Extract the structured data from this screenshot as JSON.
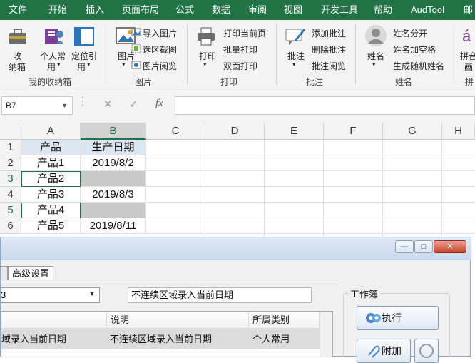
{
  "ribbon_tabs": [
    "文件",
    "开始",
    "插入",
    "页面布局",
    "公式",
    "数据",
    "审阅",
    "视图",
    "开发工具",
    "帮助",
    "AudTool",
    "邮"
  ],
  "ribbon": {
    "shoubox": {
      "btn1_line1": "收",
      "btn1_line2": "纳箱",
      "btn2_line1": "个人常",
      "btn2_line2": "用",
      "btn3_line1": "定位引",
      "btn3_line2": "用",
      "group_label": "我的收纳箱"
    },
    "picture": {
      "big_label": "图片",
      "item1": "导入图片",
      "item2": "选区截图",
      "item3": "图片阅览",
      "group_label": "图片"
    },
    "print": {
      "big_label": "打印",
      "item1": "打印当前页",
      "item2": "批量打印",
      "item3": "双面打印",
      "group_label": "打印"
    },
    "comment": {
      "big_label": "批注",
      "item1": "添加批注",
      "item2": "删除批注",
      "item3": "批注阅览",
      "group_label": "批注"
    },
    "name": {
      "big_label": "姓名",
      "item1": "姓名分开",
      "item2": "姓名加空格",
      "item3": "生成随机姓名",
      "group_label": "姓名"
    },
    "pinyin": {
      "line1": "拼音",
      "line2": "画",
      "group_label": "拼"
    }
  },
  "formula_bar": {
    "name_box": "B7",
    "cancel_glyph": "✕",
    "confirm_glyph": "✓",
    "fx_glyph": "fx",
    "formula": ""
  },
  "grid": {
    "columns": [
      "A",
      "B",
      "C",
      "D",
      "E",
      "F",
      "G",
      "H"
    ],
    "selected_column": "B",
    "rows": [
      {
        "num": "1",
        "a": "产品",
        "b": "生产日期",
        "b_fill": "header"
      },
      {
        "num": "2",
        "a": "产品1",
        "b": "2019/8/2",
        "b_fill": "none"
      },
      {
        "num": "3",
        "a": "产品2",
        "b": "",
        "b_fill": "gray"
      },
      {
        "num": "4",
        "a": "产品3",
        "b": "2019/8/3",
        "b_fill": "none"
      },
      {
        "num": "5",
        "a": "产品4",
        "b": "",
        "b_fill": "gray"
      },
      {
        "num": "6",
        "a": "产品5",
        "b": "2019/8/11",
        "b_fill": "none"
      }
    ],
    "colors": {
      "header_fill": "#dce6f1",
      "gray_fill": "#c8c8c8",
      "selection": "#217346"
    }
  },
  "dialog": {
    "tab_label": "高级设置",
    "combo_value": "3",
    "description_value": "不连续区域录入当前日期",
    "list_headers": {
      "name": "",
      "description": "说明",
      "category": "所属类别"
    },
    "list_row": {
      "name": "域录入当前日期",
      "description": "不连续区域录入当前日期",
      "category": "个人常用"
    },
    "group_title": "工作簿",
    "execute_label": "执行",
    "attach_label": "附加",
    "window_buttons": {
      "minimize": "—",
      "maximize": "□",
      "close": "✕"
    }
  },
  "accent": "#217346"
}
